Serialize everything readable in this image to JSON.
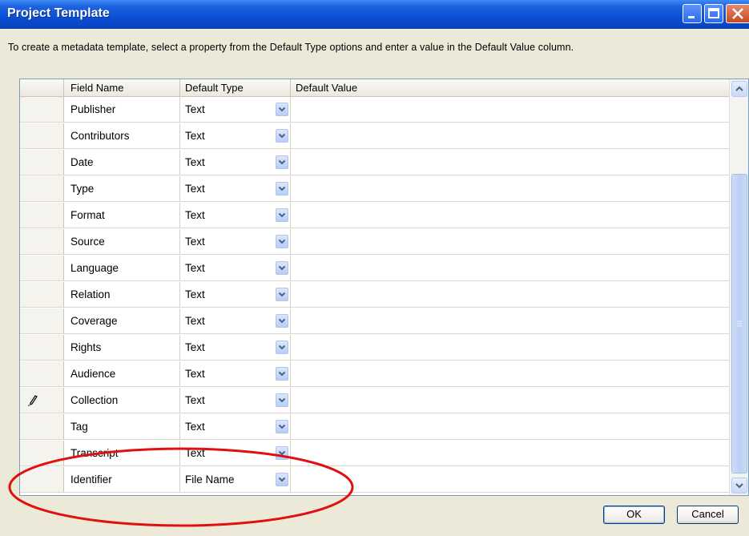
{
  "window": {
    "title": "Project Template"
  },
  "instructions": "To create a metadata template, select a property from the Default Type options and enter a value in the Default Value column.",
  "grid": {
    "columns": [
      "",
      "Field Name",
      "Default Type",
      "Default Value"
    ],
    "rows": [
      {
        "field": "Publisher",
        "type": "Text",
        "value": ""
      },
      {
        "field": "Contributors",
        "type": "Text",
        "value": ""
      },
      {
        "field": "Date",
        "type": "Text",
        "value": ""
      },
      {
        "field": "Type",
        "type": "Text",
        "value": ""
      },
      {
        "field": "Format",
        "type": "Text",
        "value": ""
      },
      {
        "field": "Source",
        "type": "Text",
        "value": ""
      },
      {
        "field": "Language",
        "type": "Text",
        "value": ""
      },
      {
        "field": "Relation",
        "type": "Text",
        "value": ""
      },
      {
        "field": "Coverage",
        "type": "Text",
        "value": ""
      },
      {
        "field": "Rights",
        "type": "Text",
        "value": ""
      },
      {
        "field": "Audience",
        "type": "Text",
        "value": ""
      },
      {
        "field": "Collection",
        "type": "Text",
        "value": "",
        "editing": true
      },
      {
        "field": "Tag",
        "type": "Text",
        "value": ""
      },
      {
        "field": "Transcript",
        "type": "Text",
        "value": ""
      },
      {
        "field": "Identifier",
        "type": "File Name",
        "value": ""
      }
    ]
  },
  "buttons": {
    "ok": "OK",
    "cancel": "Cancel"
  },
  "colors": {
    "titlebar": "#0b4fd6",
    "highlight_ellipse": "#e01010",
    "accent": "#b7cdf7"
  }
}
